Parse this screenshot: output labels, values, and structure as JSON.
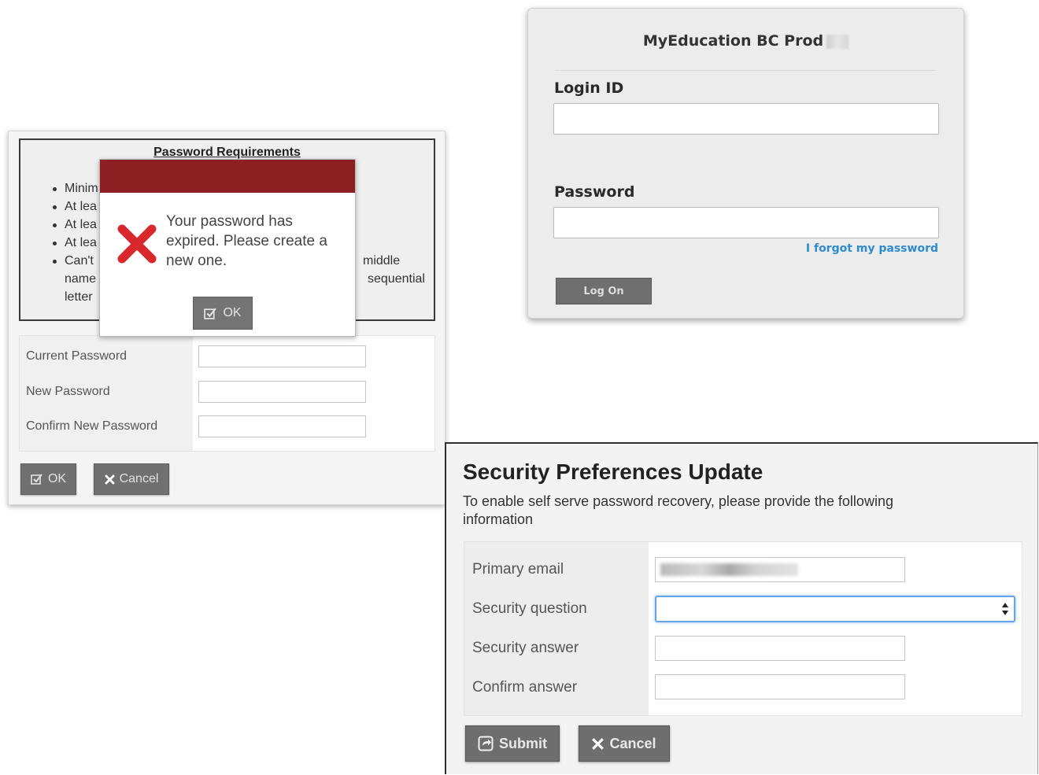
{
  "login": {
    "title": "MyEducation BC Prod",
    "login_id_label": "Login ID",
    "password_label": "Password",
    "forgot_link": "I forgot my password",
    "logon_button": "Log On"
  },
  "password_change": {
    "requirements_title": "Password Requirements",
    "requirements": [
      "Minim",
      "At lea",
      "At lea",
      "At lea",
      "Can't"
    ],
    "requirements_overflow_right": [
      "middle",
      "sequential"
    ],
    "requirements_overflow_left": [
      "name",
      "letter"
    ],
    "current_password_label": "Current Password",
    "new_password_label": "New Password",
    "confirm_password_label": "Confirm New Password",
    "ok_button": "OK",
    "cancel_button": "Cancel"
  },
  "expired_modal": {
    "message": "Your password has expired. Please create a new one.",
    "ok_button": "OK",
    "error_color": "#d9272e",
    "header_color": "#8b1f22"
  },
  "security_prefs": {
    "title": "Security Preferences Update",
    "description": "To enable self serve password recovery, please provide the following information",
    "primary_email_label": "Primary email",
    "security_question_label": "Security question",
    "security_answer_label": "Security answer",
    "confirm_answer_label": "Confirm answer",
    "submit_button": "Submit",
    "cancel_button": "Cancel"
  }
}
